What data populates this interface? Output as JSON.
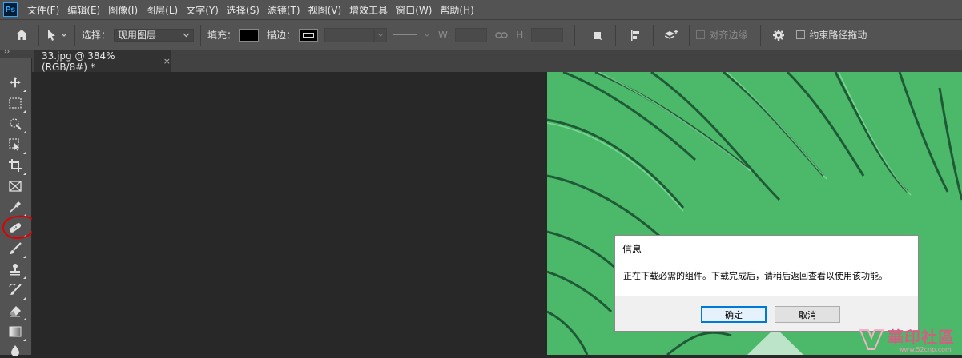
{
  "menubar": {
    "logo": "Ps",
    "items": [
      "文件(F)",
      "编辑(E)",
      "图像(I)",
      "图层(L)",
      "文字(Y)",
      "选择(S)",
      "滤镜(T)",
      "视图(V)",
      "增效工具",
      "窗口(W)",
      "帮助(H)"
    ]
  },
  "options": {
    "select_label": "选择：",
    "select_value": "现用图层",
    "fill_label": "填充：",
    "stroke_label": "描边：",
    "w_label": "W:",
    "h_label": "H:",
    "align_edges_label": "对齐边缘",
    "constrain_path_label": "约束路径拖动"
  },
  "document": {
    "tab_label": "33.jpg @ 384%(RGB/8#) *",
    "close_symbol": "×"
  },
  "toolbar": {
    "collapse_symbol": "››",
    "tools": [
      "move-icon",
      "marquee-icon",
      "quick-select-icon",
      "object-select-icon",
      "crop-icon",
      "frame-icon",
      "eyedropper-icon",
      "healing-brush-icon",
      "brush-icon",
      "stamp-icon",
      "history-brush-icon",
      "eraser-icon",
      "gradient-icon",
      "blur-icon"
    ]
  },
  "dialog": {
    "title": "信息",
    "message": "正在下载必需的组件。下载完成后，请稍后返回查看以使用该功能。",
    "ok_label": "确定",
    "cancel_label": "取消"
  },
  "watermark": {
    "text": "華印社區",
    "url": "www.52cnp.com"
  },
  "colors": {
    "ps_accent": "#31a8ff",
    "annotation_red": "#e00000",
    "canvas_green": "#4cb86a"
  }
}
